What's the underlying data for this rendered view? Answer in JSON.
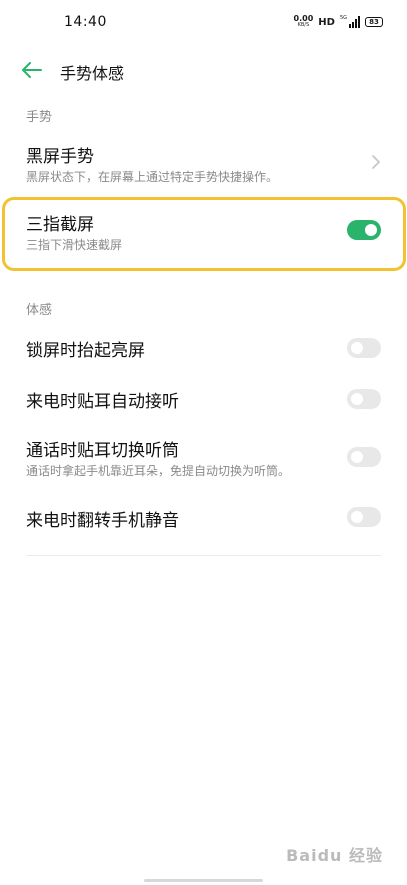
{
  "status_bar": {
    "time": "14:40",
    "net_speed_value": "0.00",
    "net_speed_unit": "KB/S",
    "hd_label": "HD",
    "signal_label": "5G",
    "battery": "83"
  },
  "header": {
    "title": "手势体感"
  },
  "sections": {
    "gesture_label": "手势",
    "motion_label": "体感"
  },
  "gesture_items": {
    "black_screen": {
      "title": "黑屏手势",
      "subtitle": "黑屏状态下，在屏幕上通过特定手势快捷操作。"
    },
    "three_finger": {
      "title": "三指截屏",
      "subtitle": "三指下滑快速截屏",
      "enabled": true
    }
  },
  "motion_items": [
    {
      "title": "锁屏时抬起亮屏",
      "subtitle": "",
      "enabled": false
    },
    {
      "title": "来电时贴耳自动接听",
      "subtitle": "",
      "enabled": false
    },
    {
      "title": "通话时贴耳切换听筒",
      "subtitle": "通话时拿起手机靠近耳朵，免提自动切换为听筒。",
      "enabled": false
    },
    {
      "title": "来电时翻转手机静音",
      "subtitle": "",
      "enabled": false
    }
  ],
  "watermark": "Baidu 经验",
  "colors": {
    "accent": "#2ab36a",
    "highlight": "#f2c230",
    "toggle_off": "#e8e8e8"
  }
}
